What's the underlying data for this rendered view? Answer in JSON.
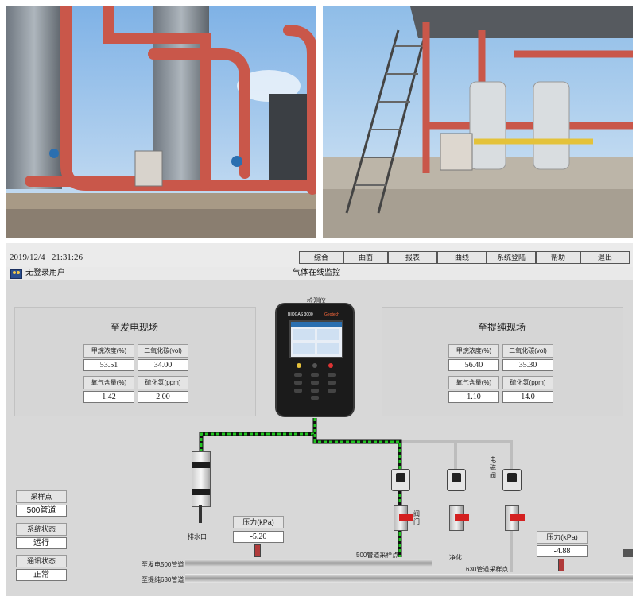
{
  "photos": {
    "left": {
      "subject": "pipeline-site-with-analyzer-cabinet"
    },
    "right": {
      "subject": "purification-plant-with-analyzer-cabinet"
    }
  },
  "hmi": {
    "datetime": "2019/12/4   21:31:26",
    "handle_glyph": "≡ ⌄",
    "menu": [
      "综合",
      "曲面",
      "报表",
      "曲线",
      "系统登陆",
      "帮助",
      "退出"
    ],
    "user_status": "无登录用户",
    "screen_title": "气体在线监控",
    "analyzer_label": "检测仪",
    "device_brand": "BIOGAS 3000",
    "device_brand2": "Geotech",
    "left_site": {
      "title": "至发电现场",
      "labels": [
        "甲烷浓度(%)",
        "二氧化碳(vol)",
        "氧气含量(%)",
        "硫化氢(ppm)"
      ],
      "values": [
        "53.51",
        "34.00",
        "1.42",
        "2.00"
      ]
    },
    "right_site": {
      "title": "至提纯现场",
      "labels": [
        "甲烷浓度(%)",
        "二氧化碳(vol)",
        "氧气含量(%)",
        "硫化氢(ppm)"
      ],
      "values": [
        "56.40",
        "35.30",
        "1.10",
        "14.0"
      ]
    },
    "status": {
      "sampling_label": "采样点",
      "sampling_value": "500管道",
      "system_label": "系统状态",
      "system_value": "运行",
      "comm_label": "通讯状态",
      "comm_value": "正常"
    },
    "pressure_left": {
      "label": "压力(kPa)",
      "value": "-5.20"
    },
    "pressure_right": {
      "label": "压力(kPa)",
      "value": "-4.88"
    },
    "labels": {
      "drain": "排水口",
      "valve": "阀\n门",
      "solenoid": "电\n磁\n阀",
      "purify": "净化",
      "sample_500": "500管道采样点",
      "sample_630": "630管道采样点",
      "pipe_500": "至发电500管道",
      "pipe_630": "至提纯630管道"
    },
    "colors": {
      "line_active": "#22c422",
      "line_idle": "#bdbdbd",
      "valve_red": "#d42020"
    }
  }
}
